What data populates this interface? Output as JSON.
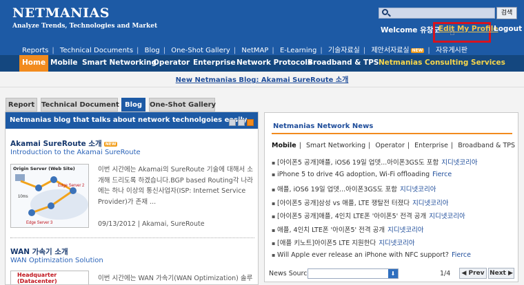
{
  "header": {
    "logo": "NETMANIAS",
    "tagline": "Analyze Trends, Technologies and Market",
    "search_button": "검색",
    "welcome": "Welcome 유창모",
    "edit_profile": "Edit My Profile",
    "logout": "Logout",
    "subnav": [
      "Reports",
      "Technical Documents",
      "Blog",
      "One-Shot Gallery",
      "NetMAP",
      "E-Learning",
      "기술자료실",
      "제안서자료실",
      "자유게시판"
    ],
    "subnav_new_badge": "NEW",
    "mainnav": [
      "Home",
      "Mobile",
      "Smart Networking",
      "Operator",
      "Enterprise",
      "Network Protocols",
      "Broadband & TPS",
      "Netmanias Consulting Services"
    ]
  },
  "banner": "New Netmanias Blog: Akamai SureRoute 소개",
  "tabs": [
    "Report",
    "Technical Document",
    "Blog",
    "One-Shot Gallery"
  ],
  "blog": {
    "heading": "Netmanias blog that talks about network technolgoies easily",
    "posts": [
      {
        "title": "Akamai SureRoute 소개",
        "new_badge": "NEW",
        "subtitle": "Introduction to the Akamai SureRoute",
        "thumb_label": "Origin Server (Web Site)",
        "thumb_text_1": "Edge Server 2",
        "thumb_text_2": "10ms",
        "thumb_text_3": "Edge Server 3",
        "excerpt": "이번 시간에는 Akamai의 SureRoute 기술에 대해서 소개해 드리도록 하겠습니다.BGP based Routing각 나라에는 하나 이상의 통신사업자(ISP: Internet Service Provider)가 존재 ...",
        "meta": "09/13/2012 | Akamai, SureRoute"
      },
      {
        "title": "WAN 가속기 소개",
        "subtitle": "WAN Optimization Solution",
        "thumb_label": "Headquarter (Datacenter)",
        "excerpt": "이번 시간에는 WAN 가속기(WAN Optimization) 솔루"
      }
    ]
  },
  "news": {
    "heading": "Netmanias Network News",
    "tabs": [
      "Mobile",
      "Smart Networking",
      "Operator",
      "Enterprise",
      "Broadband & TPS"
    ],
    "items": [
      {
        "text": "[아이폰5 공개]애플, iOS6 19일 업뎃...아이폰3GS도 포함",
        "source": "지디넷코리아"
      },
      {
        "text": "iPhone 5 to drive 4G adoption, Wi-Fi offloading",
        "source": "Fierce"
      },
      {
        "text": "애플, iOS6 19일 업뎃...아이폰3GS도 포함",
        "source": "지디넷코리아"
      },
      {
        "text": "[아이폰5 공개]삼성 vs 애플, LTE 쟁탈전 터졌다",
        "source": "지디넷코리아"
      },
      {
        "text": "[아이폰5 공개]애플, 4인치 LTE폰 '아이폰5' 전격 공개",
        "source": "지디넷코리아"
      },
      {
        "text": "애플, 4인치 LTE폰 '아이폰5' 전격 공개",
        "source": "지디넷코리아"
      },
      {
        "text": "[애플 키노트]아이폰5 LTE 지원한다",
        "source": "지디넷코리아"
      },
      {
        "text": "Will Apple ever release an iPhone with NFC support?",
        "source": "Fierce"
      }
    ],
    "source_label": "News Source:",
    "page": "1/4",
    "prev": "◀ Prev",
    "next": "Next ▶"
  }
}
